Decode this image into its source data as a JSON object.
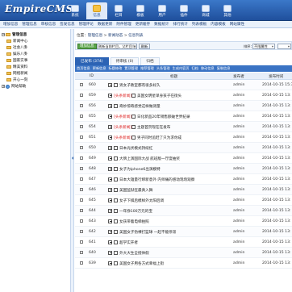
{
  "logo": "EmpireCMS",
  "topnav": [
    {
      "label": "系统",
      "active": false
    },
    {
      "label": "信息",
      "active": true
    },
    {
      "label": "栏目",
      "active": false
    },
    {
      "label": "模板",
      "active": false
    },
    {
      "label": "用户",
      "active": false
    },
    {
      "label": "插件",
      "active": false
    },
    {
      "label": "商城",
      "active": false
    },
    {
      "label": "其他",
      "active": false
    }
  ],
  "menubar": [
    "增加信息",
    "管理信息",
    "审核信息",
    "签发信息",
    "管理评论",
    "数据更新",
    "附件管理",
    "更新缓存",
    "数据统计",
    "排行统计",
    "列表模板",
    "内容模板",
    "网站属性"
  ],
  "sidebar": {
    "root": "管理信息",
    "items": [
      "新闻中心",
      "社会八卦",
      "娱乐八卦",
      "国家实事",
      "精美资料",
      "网络新闻",
      "开心一刻"
    ],
    "extra": "网站帮助"
  },
  "breadcrumb": {
    "prefix": "位置：",
    "parts": [
      "管理信息",
      "新闻动态",
      "信息列表"
    ]
  },
  "toolbar": {
    "add_label": "增加信息",
    "select1": "刷新当前栏目，父栏目与首页",
    "refresh_label": "刷新",
    "sort_label": "排序：",
    "select2": "不限属性",
    "select3": "▾"
  },
  "tabs": [
    {
      "label": "已发布 (374)",
      "active": true
    },
    {
      "label": "待审核 (0)",
      "active": false
    },
    {
      "label": "归档",
      "active": false
    }
  ],
  "subbar": [
    "首页信息",
    "更新信息",
    "标题修改",
    "置顶管理",
    "推荐管理",
    "头条管理",
    "生成内容页",
    "归档",
    "移动信息",
    "复制信息"
  ],
  "table": {
    "headers": {
      "id": "ID",
      "title": "标题",
      "author": "发布者",
      "time": "发布时间"
    },
    "rows": [
      {
        "id": "660",
        "tag": "",
        "title": "男女子教室都有很多好久",
        "author": "admin",
        "time": "2014-10-15 15:3"
      },
      {
        "id": "659",
        "tag": "[头条新闻]",
        "title": "美国女明星单身孩子在街头",
        "author": "admin",
        "time": "2014-10-15 13:"
      },
      {
        "id": "656",
        "tag": "",
        "title": "奇妙惊奇感觉这样做测量",
        "author": "admin",
        "time": "2014-10-15 13:"
      },
      {
        "id": "655",
        "tag": "[头条新闻]",
        "title": "日化新品20年销售额破世界纪录",
        "author": "admin",
        "time": "2014-10-15 13:"
      },
      {
        "id": "654",
        "tag": "[头条新闻]",
        "title": "主题首页现在在发布",
        "author": "admin",
        "time": "2014-10-15 13:"
      },
      {
        "id": "651",
        "tag": "[头条新闻]",
        "title": "男子同时追赶了只为求你成",
        "author": "admin",
        "time": "2014-10-15 13:"
      },
      {
        "id": "650",
        "tag": "",
        "title": "日本光伏模式持续红",
        "author": "admin",
        "time": "2014-10-15 13:"
      },
      {
        "id": "649",
        "tag": "",
        "title": "大牌上演国际大战 航班版一厅度抽奖",
        "author": "admin",
        "time": "2014-10-15 13:"
      },
      {
        "id": "648",
        "tag": "",
        "title": "女子为iphone6出演模特",
        "author": "admin",
        "time": "2014-10-15 13:"
      },
      {
        "id": "647",
        "tag": "",
        "title": "日本大雄量行绑新意外 内师痛的感动现场观察",
        "author": "admin",
        "time": "2014-10-15 13:"
      },
      {
        "id": "646",
        "tag": "",
        "title": "美国监狱狂最真入舞",
        "author": "admin",
        "time": "2014-10-15 13:"
      },
      {
        "id": "645",
        "tag": "",
        "title": "女子下棋后模样外太阳后调",
        "author": "admin",
        "time": "2014-10-15 13:"
      },
      {
        "id": "644",
        "tag": "",
        "title": "一年挣100万元的宝",
        "author": "admin",
        "time": "2014-10-15 13:"
      },
      {
        "id": "643",
        "tag": "",
        "title": "女孩带着电梯拍照",
        "author": "admin",
        "time": "2014-10-15 13:"
      },
      {
        "id": "642",
        "tag": "",
        "title": "美国女子伪裸打篮球 一起不能停滞",
        "author": "admin",
        "time": "2014-10-15 13:"
      },
      {
        "id": "641",
        "tag": "",
        "title": "超学实开者",
        "author": "admin",
        "time": "2014-10-15 13:"
      },
      {
        "id": "640",
        "tag": "",
        "title": "外大大生全授休假",
        "author": "admin",
        "time": "2014-10-15 13:"
      },
      {
        "id": "639",
        "tag": "",
        "title": "美国女子用各方式幸福上街",
        "author": "admin",
        "time": "2014-10-15 13:"
      }
    ]
  }
}
